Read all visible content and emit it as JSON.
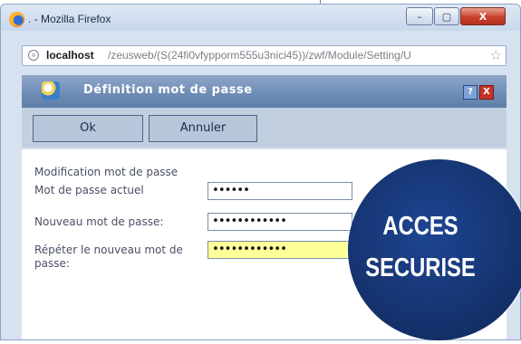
{
  "browser": {
    "title": ". - Mozilla Firefox",
    "url_host": "localhost",
    "url_path": "/zeusweb/(S(24fi0vfypporm555u3nici45))/zwf/Module/Setting/U",
    "controls": {
      "minimize": "–",
      "maximize": "▢",
      "close": "X"
    },
    "star": "☆"
  },
  "dialog": {
    "title": "Définition mot de passe",
    "help_label": "?",
    "close_label": "X"
  },
  "toolbar": {
    "ok_label": "Ok",
    "cancel_label": "Annuler"
  },
  "form": {
    "section_title": "Modification mot de passe",
    "fields": [
      {
        "label": "Mot de passe actuel",
        "value": "••••••"
      },
      {
        "label": "Nouveau mot de passe:",
        "value": "••••••••••••"
      },
      {
        "label": "Répéter le nouveau mot de passe:",
        "value": "••••••••••••"
      }
    ]
  },
  "badge": {
    "line1": "ACCES",
    "line2": "SECURISE"
  }
}
